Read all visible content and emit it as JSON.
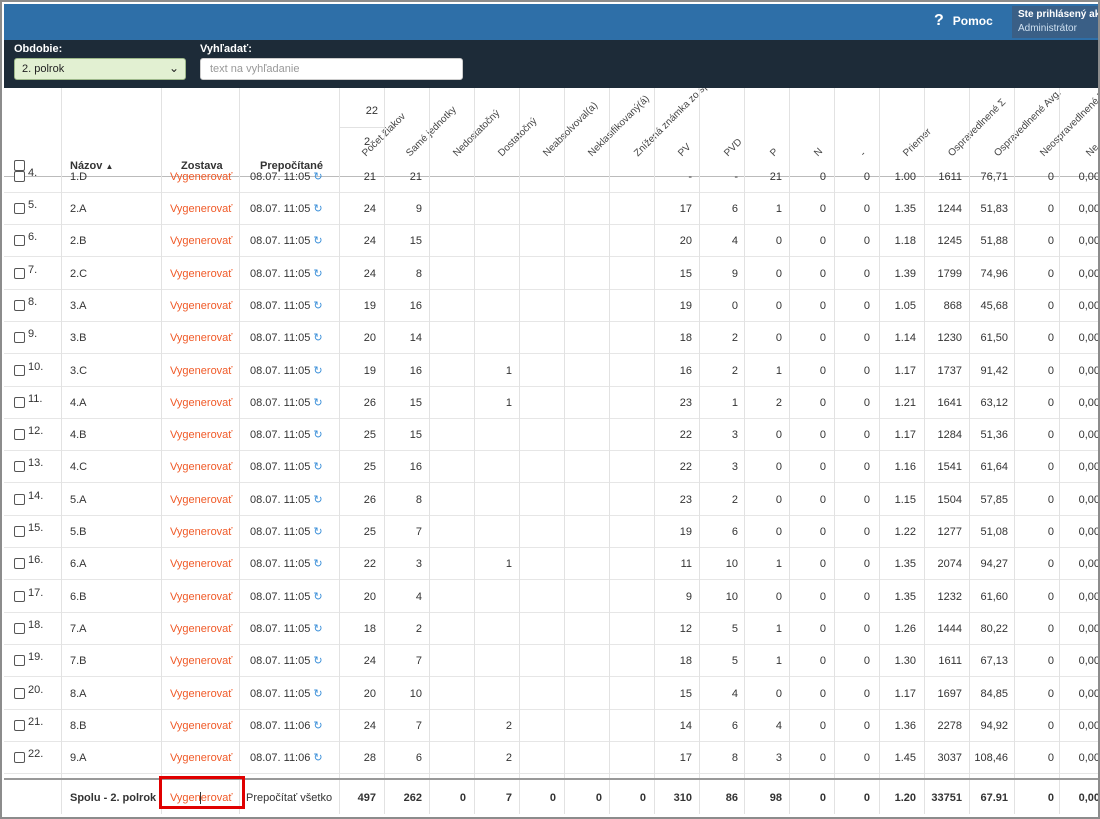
{
  "header": {
    "help_label": "Pomoc",
    "help_icon": "question-icon",
    "user_line1": "Ste prihlásený ako",
    "user_line2": "Administrátor"
  },
  "filters": {
    "period_label": "Obdobie:",
    "period_value": "2. polrok",
    "search_label": "Vyhľadať:",
    "search_placeholder": "text na vyhľadanie"
  },
  "columns": {
    "name": "Názov",
    "report": "Zostava",
    "recalc": "Prepočítané",
    "count_top": "22",
    "count_top2": "2",
    "rotated": [
      "Počet žiakov",
      "Samé jednotky",
      "Nedostatočný",
      "Dostatočný",
      "Neabsolvoval(a)",
      "Neklasifikovaný(á)",
      "Znížená známka zo správania",
      "PV",
      "PVD",
      "P",
      "N",
      "-",
      "Priemer",
      "Ospravedlnené Σ",
      "Ospravedlnené Avg.",
      "Neospravedlnené Σ",
      "Ne"
    ]
  },
  "partial_row": {
    "num": "4.",
    "name": "1.D",
    "report": "Vygenerovať",
    "date": "08.07. 11:05",
    "v": [
      "21",
      "21",
      "",
      "",
      "",
      "",
      "",
      "-",
      "-",
      "21",
      "0",
      "0",
      "1.00",
      "1611",
      "76,71",
      "0",
      "0,00"
    ]
  },
  "rows": [
    {
      "num": "5.",
      "name": "2.A",
      "report": "Vygenerovať",
      "date": "08.07. 11:05",
      "v": [
        "24",
        "9",
        "",
        "",
        "",
        "",
        "",
        "17",
        "6",
        "1",
        "0",
        "0",
        "1.35",
        "1244",
        "51,83",
        "0",
        "0,00"
      ]
    },
    {
      "num": "6.",
      "name": "2.B",
      "report": "Vygenerovať",
      "date": "08.07. 11:05",
      "v": [
        "24",
        "15",
        "",
        "",
        "",
        "",
        "",
        "20",
        "4",
        "0",
        "0",
        "0",
        "1.18",
        "1245",
        "51,88",
        "0",
        "0,00"
      ]
    },
    {
      "num": "7.",
      "name": "2.C",
      "report": "Vygenerovať",
      "date": "08.07. 11:05",
      "v": [
        "24",
        "8",
        "",
        "",
        "",
        "",
        "",
        "15",
        "9",
        "0",
        "0",
        "0",
        "1.39",
        "1799",
        "74,96",
        "0",
        "0,00"
      ]
    },
    {
      "num": "8.",
      "name": "3.A",
      "report": "Vygenerovať",
      "date": "08.07. 11:05",
      "v": [
        "19",
        "16",
        "",
        "",
        "",
        "",
        "",
        "19",
        "0",
        "0",
        "0",
        "0",
        "1.05",
        "868",
        "45,68",
        "0",
        "0,00"
      ]
    },
    {
      "num": "9.",
      "name": "3.B",
      "report": "Vygenerovať",
      "date": "08.07. 11:05",
      "v": [
        "20",
        "14",
        "",
        "",
        "",
        "",
        "",
        "18",
        "2",
        "0",
        "0",
        "0",
        "1.14",
        "1230",
        "61,50",
        "0",
        "0,00"
      ]
    },
    {
      "num": "10.",
      "name": "3.C",
      "report": "Vygenerovať",
      "date": "08.07. 11:05",
      "v": [
        "19",
        "16",
        "",
        "1",
        "",
        "",
        "",
        "16",
        "2",
        "1",
        "0",
        "0",
        "1.17",
        "1737",
        "91,42",
        "0",
        "0,00"
      ]
    },
    {
      "num": "11.",
      "name": "4.A",
      "report": "Vygenerovať",
      "date": "08.07. 11:05",
      "v": [
        "26",
        "15",
        "",
        "1",
        "",
        "",
        "",
        "23",
        "1",
        "2",
        "0",
        "0",
        "1.21",
        "1641",
        "63,12",
        "0",
        "0,00"
      ]
    },
    {
      "num": "12.",
      "name": "4.B",
      "report": "Vygenerovať",
      "date": "08.07. 11:05",
      "v": [
        "25",
        "15",
        "",
        "",
        "",
        "",
        "",
        "22",
        "3",
        "0",
        "0",
        "0",
        "1.17",
        "1284",
        "51,36",
        "0",
        "0,00"
      ]
    },
    {
      "num": "13.",
      "name": "4.C",
      "report": "Vygenerovať",
      "date": "08.07. 11:05",
      "v": [
        "25",
        "16",
        "",
        "",
        "",
        "",
        "",
        "22",
        "3",
        "0",
        "0",
        "0",
        "1.16",
        "1541",
        "61,64",
        "0",
        "0,00"
      ]
    },
    {
      "num": "14.",
      "name": "5.A",
      "report": "Vygenerovať",
      "date": "08.07. 11:05",
      "v": [
        "26",
        "8",
        "",
        "",
        "",
        "",
        "",
        "23",
        "2",
        "0",
        "0",
        "0",
        "1.15",
        "1504",
        "57,85",
        "0",
        "0,00"
      ]
    },
    {
      "num": "15.",
      "name": "5.B",
      "report": "Vygenerovať",
      "date": "08.07. 11:05",
      "v": [
        "25",
        "7",
        "",
        "",
        "",
        "",
        "",
        "19",
        "6",
        "0",
        "0",
        "0",
        "1.22",
        "1277",
        "51,08",
        "0",
        "0,00"
      ]
    },
    {
      "num": "16.",
      "name": "6.A",
      "report": "Vygenerovať",
      "date": "08.07. 11:05",
      "v": [
        "22",
        "3",
        "",
        "1",
        "",
        "",
        "",
        "11",
        "10",
        "1",
        "0",
        "0",
        "1.35",
        "2074",
        "94,27",
        "0",
        "0,00"
      ]
    },
    {
      "num": "17.",
      "name": "6.B",
      "report": "Vygenerovať",
      "date": "08.07. 11:05",
      "v": [
        "20",
        "4",
        "",
        "",
        "",
        "",
        "",
        "9",
        "10",
        "0",
        "0",
        "0",
        "1.35",
        "1232",
        "61,60",
        "0",
        "0,00"
      ]
    },
    {
      "num": "18.",
      "name": "7.A",
      "report": "Vygenerovať",
      "date": "08.07. 11:05",
      "v": [
        "18",
        "2",
        "",
        "",
        "",
        "",
        "",
        "12",
        "5",
        "1",
        "0",
        "0",
        "1.26",
        "1444",
        "80,22",
        "0",
        "0,00"
      ]
    },
    {
      "num": "19.",
      "name": "7.B",
      "report": "Vygenerovať",
      "date": "08.07. 11:05",
      "v": [
        "24",
        "7",
        "",
        "",
        "",
        "",
        "",
        "18",
        "5",
        "1",
        "0",
        "0",
        "1.30",
        "1611",
        "67,13",
        "0",
        "0,00"
      ]
    },
    {
      "num": "20.",
      "name": "8.A",
      "report": "Vygenerovať",
      "date": "08.07. 11:05",
      "v": [
        "20",
        "10",
        "",
        "",
        "",
        "",
        "",
        "15",
        "4",
        "0",
        "0",
        "0",
        "1.17",
        "1697",
        "84,85",
        "0",
        "0,00"
      ]
    },
    {
      "num": "21.",
      "name": "8.B",
      "report": "Vygenerovať",
      "date": "08.07. 11:06",
      "v": [
        "24",
        "7",
        "",
        "2",
        "",
        "",
        "",
        "14",
        "6",
        "4",
        "0",
        "0",
        "1.36",
        "2278",
        "94,92",
        "0",
        "0,00"
      ]
    },
    {
      "num": "22.",
      "name": "9.A",
      "report": "Vygenerovať",
      "date": "08.07. 11:06",
      "v": [
        "28",
        "6",
        "",
        "2",
        "",
        "",
        "",
        "17",
        "8",
        "3",
        "0",
        "0",
        "1.45",
        "3037",
        "108,46",
        "0",
        "0,00"
      ]
    }
  ],
  "total": {
    "label": "Spolu - 2. polrok",
    "report_a": "Vygen",
    "report_b": "erovať",
    "recalc": "Prepočítať všetko",
    "v": [
      "497",
      "262",
      "0",
      "7",
      "0",
      "0",
      "0",
      "310",
      "86",
      "98",
      "0",
      "0",
      "1.20",
      "33751",
      "67.91",
      "0",
      "0,00"
    ]
  }
}
